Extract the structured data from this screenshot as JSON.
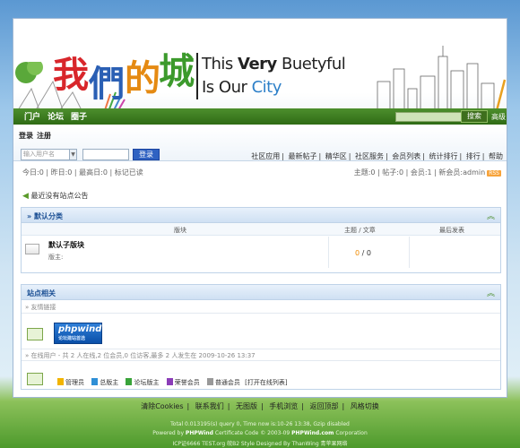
{
  "banner": {
    "logo_cn": [
      "我",
      "們",
      "的",
      "城"
    ],
    "logo_en_line1_a": "This ",
    "logo_en_line1_b": "Very",
    "logo_en_line1_c": " Buetyful",
    "logo_en_line2_a": "Is Our ",
    "logo_en_line2_b": "City"
  },
  "nav": {
    "portal": "门户",
    "forum": "论坛",
    "album": "圈子",
    "search_button": "搜索",
    "advanced": "高级"
  },
  "login": {
    "login_link": "登录",
    "register_link": "注册",
    "username_placeholder": "输入用户名",
    "login_button": "登录"
  },
  "menu": [
    "社区应用",
    "最新帖子",
    "精华区",
    "社区服务",
    "会员列表",
    "统计排行",
    "排行",
    "帮助"
  ],
  "stats": {
    "left": "今日:0 | 昨日:0 | 最高日:0 | 标记已读",
    "right": "主题:0 | 帖子:0 | 会员:1 | 新会员:admin",
    "rss": "RSS"
  },
  "notice": "最近没有站点公告",
  "category": {
    "title": "» 默认分类",
    "col_forum": "版块",
    "col_topics": "主题 / 文章",
    "col_last": "最后发表",
    "forum_name": "默认子版块",
    "forum_mod": "版主:",
    "topics": "0",
    "posts": " / 0"
  },
  "site": {
    "title": "站点相关",
    "friend_links": "» 友情链接",
    "pw_logo": "phpwind",
    "pw_logo_sub": "论坛建站首选",
    "online_line": "» 在线用户 - 共 2 人在线,2 位会员,0 位访客,最多 2 人发生在 2009-10-26 13:37",
    "legend": [
      "管理员",
      "总版主",
      "论坛版主",
      "荣誉会员",
      "普通会员",
      "[打开在线列表]"
    ]
  },
  "footer": {
    "links": [
      "清除Cookies",
      "联系我们",
      "无图版",
      "手机浏览",
      "返回顶部",
      "风格切换"
    ],
    "line1": "Total 0.013195(s) query 0, Time now is:10-26 13:38, Gzip disabled",
    "line2_a": "Powered by ",
    "line2_b": "PHPWind",
    "line2_c": " Certificate Code © 2003-09 ",
    "line2_d": "PHPWind.com",
    "line2_e": " Corporation",
    "line3": "ICP证6666 TEST.org 皖B2 Style Designed By ThanWing 青苹果网络"
  }
}
